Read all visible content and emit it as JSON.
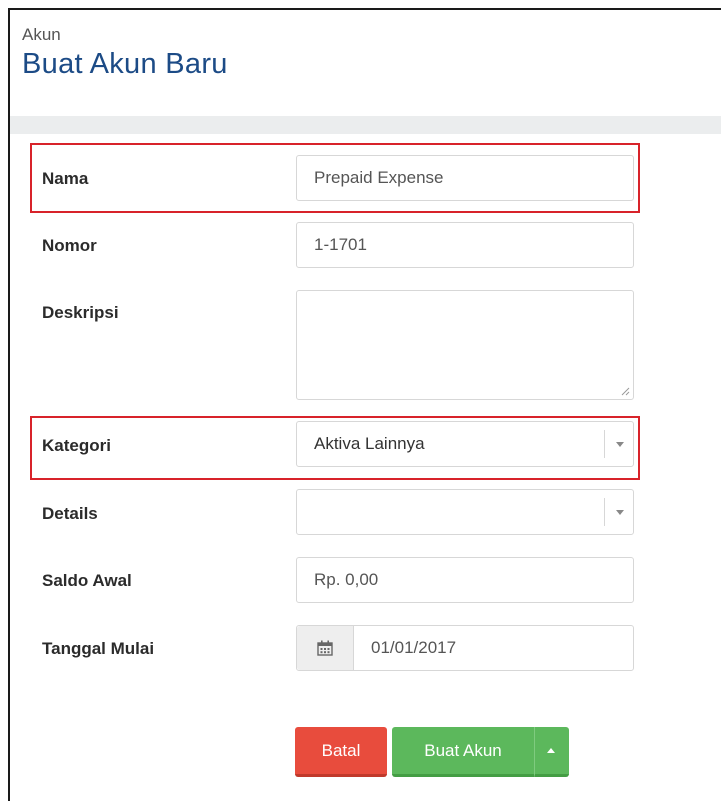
{
  "header": {
    "breadcrumb": "Akun",
    "title": "Buat Akun Baru"
  },
  "form": {
    "nama": {
      "label": "Nama",
      "value": "Prepaid Expense"
    },
    "nomor": {
      "label": "Nomor",
      "value": "1-1701"
    },
    "deskripsi": {
      "label": "Deskripsi",
      "value": ""
    },
    "kategori": {
      "label": "Kategori",
      "value": "Aktiva Lainnya"
    },
    "details": {
      "label": "Details",
      "value": ""
    },
    "saldo_awal": {
      "label": "Saldo Awal",
      "value": "Rp. 0,00"
    },
    "tanggal_mulai": {
      "label": "Tanggal Mulai",
      "value": "01/01/2017"
    }
  },
  "actions": {
    "cancel_label": "Batal",
    "create_label": "Buat Akun"
  },
  "icons": {
    "date_picker": "calendar-icon",
    "dropdown": "chevron-down-icon",
    "split_menu": "caret-up-icon"
  },
  "colors": {
    "title": "#1c4b86",
    "highlight": "#d8232a",
    "cancel": "#e84c3d",
    "create": "#5cb85c"
  }
}
